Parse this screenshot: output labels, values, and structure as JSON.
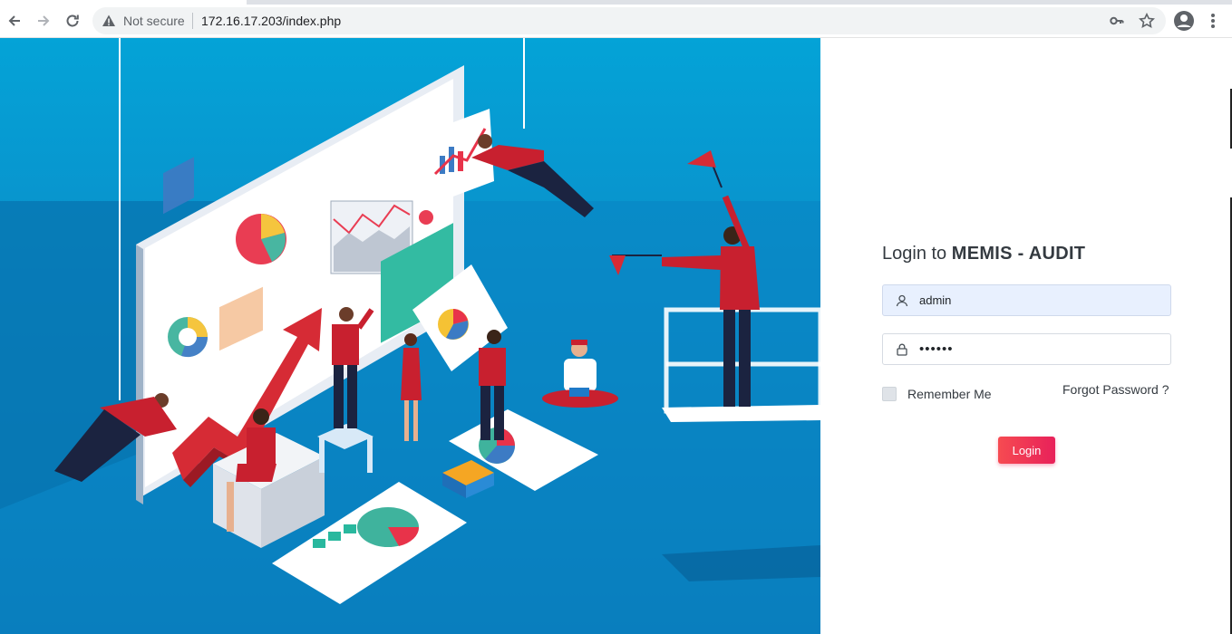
{
  "browser": {
    "security_label": "Not secure",
    "url": "172.16.17.203/index.php"
  },
  "login": {
    "title_prefix": "Login to ",
    "title_app": "MEMIS - AUDIT",
    "username_value": "admin",
    "password_value": "••••••",
    "remember_label": "Remember Me",
    "remember_checked": false,
    "forgot_label": "Forgot Password ?",
    "submit_label": "Login"
  },
  "colors": {
    "illustration_blue": "#0a8fca",
    "login_button": "#e8215a",
    "autofill_background": "#e8f0fe"
  }
}
